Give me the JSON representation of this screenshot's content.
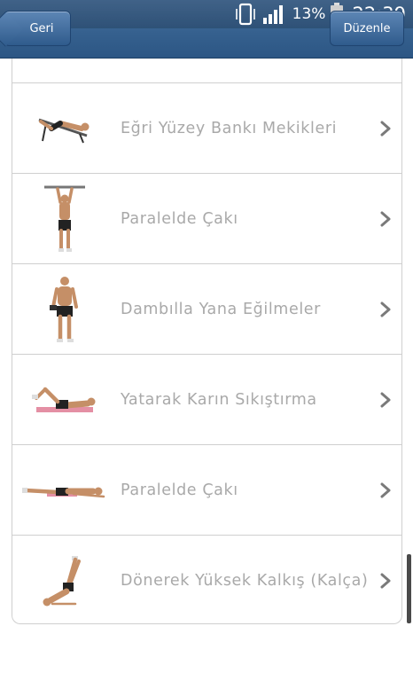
{
  "status": {
    "battery_percent": "13%",
    "time": "22:39",
    "signal_bars": 4
  },
  "nav": {
    "back_label": "Geri",
    "edit_label": "Düzenle"
  },
  "exercises": [
    {
      "label": "Eğri Yüzey Bankı Mekikleri",
      "icon": "decline-bench-situp-figure"
    },
    {
      "label": "Paralelde Çakı",
      "icon": "hanging-bar-figure"
    },
    {
      "label": "Dambılla Yana Eğilmeler",
      "icon": "dumbbell-side-bend-figure"
    },
    {
      "label": "Yatarak Karın Sıkıştırma",
      "icon": "lying-crunch-figure"
    },
    {
      "label": "Paralelde Çakı",
      "icon": "lying-leg-raise-figure"
    },
    {
      "label": "Dönerek Yüksek Kalkış (Kalça)",
      "icon": "hip-raise-figure"
    }
  ],
  "colors": {
    "topbar": "#36618f",
    "label_text": "#a9a9a9",
    "divider": "#cfcfcf"
  }
}
